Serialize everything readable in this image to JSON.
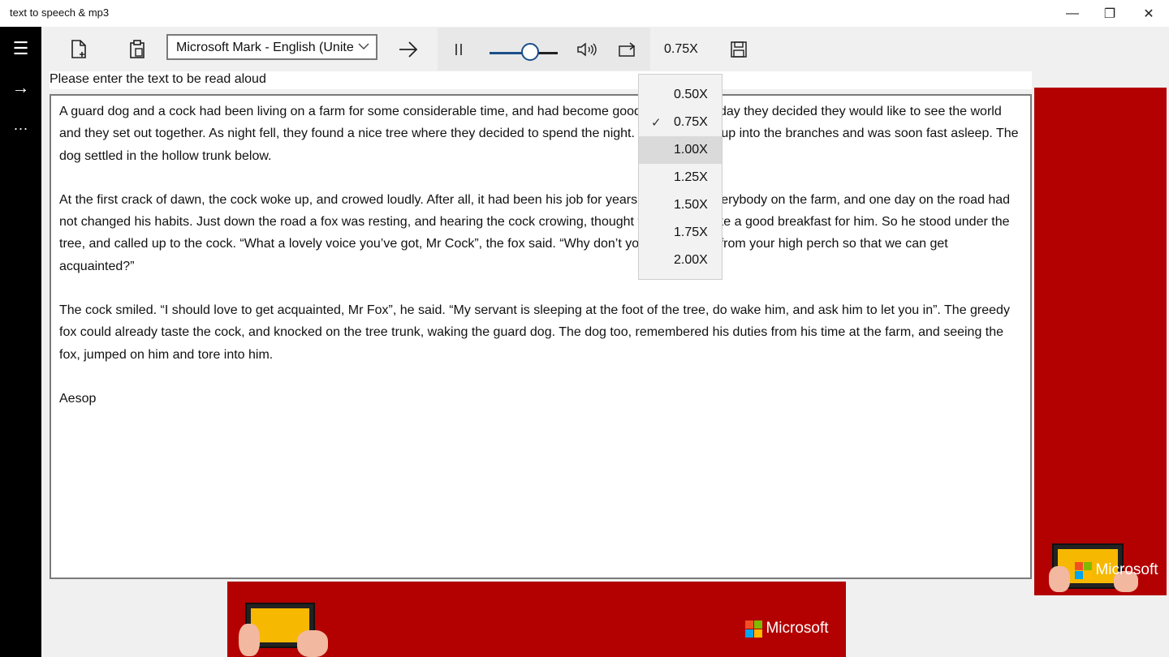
{
  "window": {
    "title": "text to speech & mp3",
    "controls": {
      "minimize": "—",
      "restore": "❐",
      "close": "✕"
    }
  },
  "rail": {
    "menu_icon": "☰",
    "go_icon": "→",
    "more_icon": "···"
  },
  "toolbar": {
    "new_icon": "new-document",
    "paste_icon": "clipboard",
    "voice": "Microsoft Mark - English (Unite",
    "voice_chevron": "⌵",
    "play_icon": "→",
    "pause_icon": "||",
    "volume_icon": "speaker",
    "repeat_icon": "loop",
    "speed": "0.75X",
    "save_icon": "floppy-disk",
    "slider_value": 0.6
  },
  "prompt": "Please enter the text to be read aloud",
  "text": {
    "paragraphs": [
      "A guard dog and a cock had been living on a farm for some considerable time, and had become good friends. One day they decided they would like to see the world and they set out together. As night fell, they found a nice tree where they decided to spend the night. The cock flew up into the branches and was soon fast asleep. The dog settled in the hollow trunk below.",
      "At the first crack of dawn, the cock woke up, and crowed loudly. After all, it had been his job for years to wake up everybody on the farm, and one day on the road had not changed his habits. Just down the road a fox was resting, and hearing the cock crowing, thought this would make a good breakfast for him. So he stood under the tree, and called up to the cock. “What a lovely voice you’ve got, Mr Cock”, the fox said. “Why don’t you come down from your high perch so that we can get acquainted?”",
      "The cock smiled. “I should love to get acquainted, Mr Fox”, he said. “My servant is sleeping at the foot of the tree, do wake him, and ask him to let you in”. The greedy fox could already taste the cock, and knocked on the tree trunk, waking the guard dog. The dog too, remembered his duties from his time at the farm, and seeing the fox, jumped on him and tore into him.",
      "Aesop"
    ]
  },
  "speed_menu": {
    "items": [
      "0.50X",
      "0.75X",
      "1.00X",
      "1.25X",
      "1.50X",
      "1.75X",
      "2.00X"
    ],
    "checked": "0.75X",
    "check_glyph": "✓",
    "hovered": "1.00X"
  },
  "ads": {
    "brand": "Microsoft",
    "color": "#b30000"
  },
  "colors": {
    "rail": "#000000",
    "accent": "#1b4f8a",
    "ad_red": "#b30000",
    "ms_red": "#f25022",
    "ms_green": "#7fba00",
    "ms_blue": "#00a4ef",
    "ms_yellow": "#ffb900"
  }
}
